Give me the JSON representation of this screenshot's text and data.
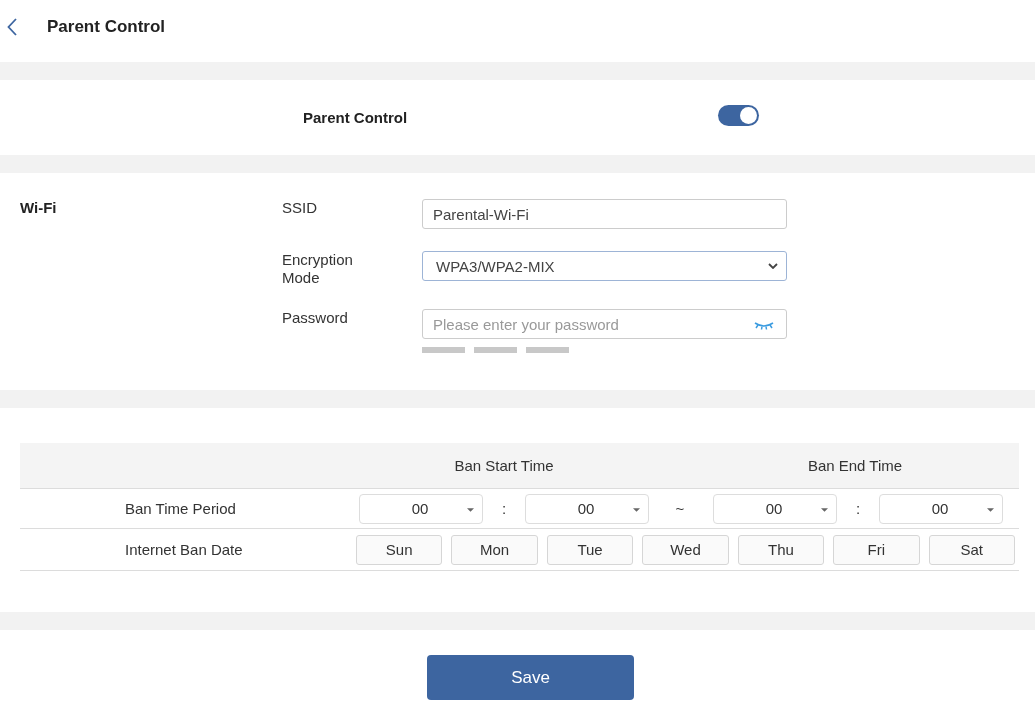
{
  "header": {
    "title": "Parent Control"
  },
  "parent_control": {
    "label": "Parent Control",
    "on": true
  },
  "wifi": {
    "title": "Wi-Fi",
    "fields": [
      {
        "kind": "text",
        "label": "SSID",
        "value": "Parental-Wi-Fi"
      },
      {
        "kind": "select",
        "label": "Encryption Mode",
        "value": "WPA3/WPA2-MIX"
      },
      {
        "kind": "password",
        "label": "Password",
        "placeholder": "Please enter your password",
        "strength": {
          "level": 0
        }
      }
    ]
  },
  "schedule": {
    "columns": [
      "Ban Start Time",
      "Ban End Time"
    ],
    "ban_time": {
      "label": "Ban Time Period",
      "start_hour": "00",
      "start_separator": ":",
      "start_minute": "00",
      "range_separator": "~",
      "end_hour": "00",
      "end_separator": ":",
      "end_minute": "00"
    },
    "ban_date": {
      "label": "Internet Ban Date",
      "days": [
        {
          "label": "Sun",
          "selected": false
        },
        {
          "label": "Mon",
          "selected": false
        },
        {
          "label": "Tue",
          "selected": false
        },
        {
          "label": "Wed",
          "selected": false
        },
        {
          "label": "Thu",
          "selected": false
        },
        {
          "label": "Fri",
          "selected": false
        },
        {
          "label": "Sat",
          "selected": false
        }
      ]
    }
  },
  "save_button": "Save"
}
